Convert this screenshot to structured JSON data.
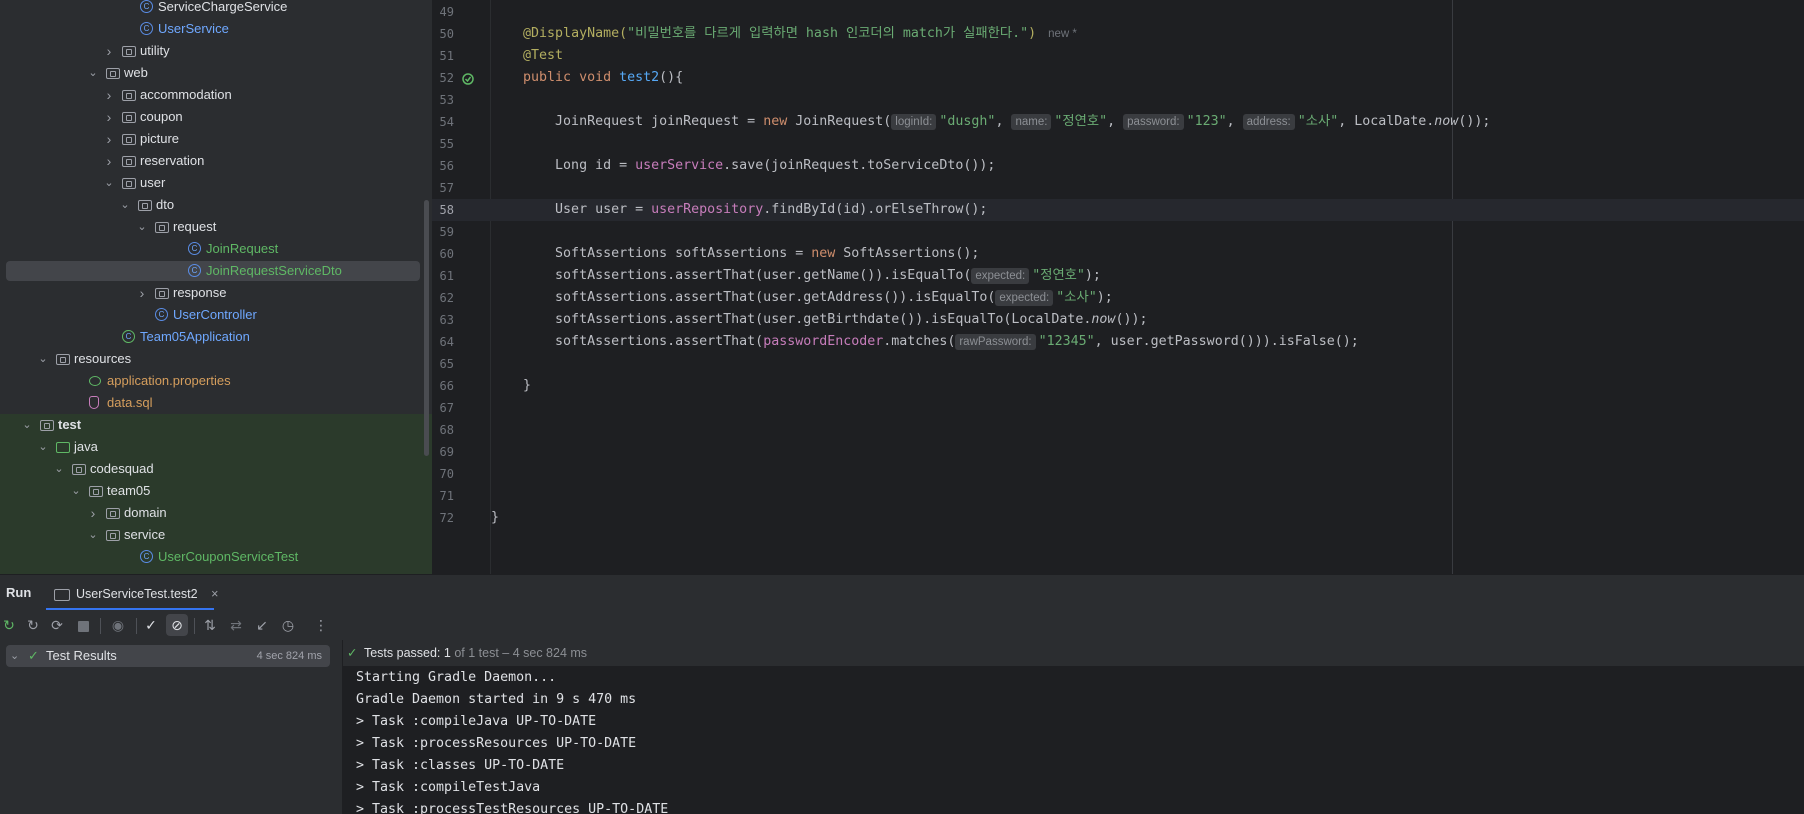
{
  "project_tree": {
    "rows": [
      {
        "label": "ServiceChargeService",
        "icon": "class-icon",
        "chevron": "",
        "color": "white"
      },
      {
        "label": "UserService",
        "icon": "class-icon",
        "chevron": "",
        "color": "blue"
      },
      {
        "label": "utility",
        "icon": "package-icon",
        "chevron": "collapsed",
        "color": "white"
      },
      {
        "label": "web",
        "icon": "package-icon",
        "chevron": "expanded",
        "color": "white"
      },
      {
        "label": "accommodation",
        "icon": "package-icon",
        "chevron": "collapsed",
        "color": "white"
      },
      {
        "label": "coupon",
        "icon": "package-icon",
        "chevron": "collapsed",
        "color": "white"
      },
      {
        "label": "picture",
        "icon": "package-icon",
        "chevron": "collapsed",
        "color": "white"
      },
      {
        "label": "reservation",
        "icon": "package-icon",
        "chevron": "collapsed",
        "color": "white"
      },
      {
        "label": "user",
        "icon": "package-icon",
        "chevron": "expanded",
        "color": "white"
      },
      {
        "label": "dto",
        "icon": "package-icon",
        "chevron": "expanded",
        "color": "white"
      },
      {
        "label": "request",
        "icon": "package-icon",
        "chevron": "expanded",
        "color": "white"
      },
      {
        "label": "JoinRequest",
        "icon": "class-icon",
        "chevron": "",
        "color": "green"
      },
      {
        "label": "JoinRequestServiceDto",
        "icon": "class-icon",
        "chevron": "",
        "color": "green",
        "selected": true
      },
      {
        "label": "response",
        "icon": "package-icon",
        "chevron": "collapsed",
        "color": "white"
      },
      {
        "label": "UserController",
        "icon": "class-icon",
        "chevron": "",
        "color": "blue"
      },
      {
        "label": "Team05Application",
        "icon": "spring-class-icon",
        "chevron": "",
        "color": "blue"
      },
      {
        "label": "resources",
        "icon": "resources-folder-icon",
        "chevron": "expanded",
        "color": "white"
      },
      {
        "label": "application.properties",
        "icon": "properties-file-icon",
        "chevron": "",
        "color": "orange"
      },
      {
        "label": "data.sql",
        "icon": "sql-file-icon",
        "chevron": "",
        "color": "orange"
      },
      {
        "label": "test",
        "icon": "test-folder-icon",
        "chevron": "expanded",
        "color": "white",
        "bold": true
      },
      {
        "label": "java",
        "icon": "source-folder-icon",
        "chevron": "expanded",
        "color": "white"
      },
      {
        "label": "codesquad",
        "icon": "package-icon",
        "chevron": "expanded",
        "color": "white"
      },
      {
        "label": "team05",
        "icon": "package-icon",
        "chevron": "expanded",
        "color": "white"
      },
      {
        "label": "domain",
        "icon": "package-icon",
        "chevron": "collapsed",
        "color": "white"
      },
      {
        "label": "service",
        "icon": "package-icon",
        "chevron": "expanded",
        "color": "white"
      },
      {
        "label": "UserCouponServiceTest",
        "icon": "test-class-icon",
        "chevron": "",
        "color": "green"
      }
    ]
  },
  "editor": {
    "line_numbers": [
      "49",
      "50",
      "51",
      "52",
      "53",
      "54",
      "55",
      "56",
      "57",
      "58",
      "59",
      "60",
      "61",
      "62",
      "63",
      "64",
      "65",
      "66",
      "67",
      "68",
      "69",
      "70",
      "71",
      "72"
    ],
    "current_line": "58",
    "tokens": {
      "display_name_ann": "@DisplayName(",
      "display_name_str": "\"비밀번호를 다르게 입력하면 hash 인코더의 match가 실패한다.\"",
      "display_name_close": ")",
      "new_hint": "new *",
      "test_ann": "@Test",
      "kw_public": "public",
      "kw_void": "void",
      "method_name": "test2",
      "method_tail": "(){",
      "l54_a": "JoinRequest joinRequest = ",
      "kw_new": "new",
      "l54_b": " JoinRequest(",
      "hint_loginId": "loginId:",
      "str_dusgh": "\"dusgh\"",
      "comma": ", ",
      "hint_name": "name:",
      "str_name": "\"정연호\"",
      "hint_password": "password:",
      "str_123": "\"123\"",
      "hint_address": "address:",
      "str_addr": "\"소사\"",
      "l54_c": ", LocalDate.",
      "now": "now",
      "l54_d": "());",
      "l56_a": "Long id = ",
      "fld_userService": "userService",
      "l56_b": ".save(joinRequest.toServiceDto());",
      "l58_a": "User user = ",
      "fld_userRepository": "userRepository",
      "l58_b": ".findById(id).orElseThrow();",
      "l60_a": "SoftAssertions softAssertions = ",
      "l60_b": " SoftAssertions();",
      "l61_a": "softAssertions.assertThat(user.getName()).isEqualTo(",
      "hint_expected": "expected:",
      "l61_b": ");",
      "l62_a": "softAssertions.assertThat(user.getAddress()).isEqualTo(",
      "l63_a": "softAssertions.assertThat(user.getBirthdate()).isEqualTo(LocalDate.",
      "l63_b": "());",
      "l64_a": "softAssertions.assertThat(",
      "fld_passwordEncoder": "passwordEncoder",
      "l64_b": ".matches(",
      "hint_rawPassword": "rawPassword:",
      "str_12345": "\"12345\"",
      "l64_c": ", user.getPassword())).isFalse();",
      "brace_close": "}"
    }
  },
  "run_panel": {
    "title": "Run",
    "tab_label": "UserServiceTest.test2",
    "tab_close": "×",
    "toolbar_icons": [
      "rerun-icon",
      "rerun-failed-icon",
      "toggle-auto-test-icon",
      "stop-icon",
      "show-ignored-icon",
      "show-passed-icon",
      "show-ignored-tests-icon",
      "sort-icon",
      "import-tests-icon",
      "export-tests-icon",
      "history-icon",
      "more-icon"
    ],
    "test_results": {
      "label": "Test Results",
      "duration": "4 sec 824 ms"
    },
    "status": {
      "label": "Tests passed:",
      "passed": "1",
      "of": "of 1 test – 4 sec 824 ms"
    },
    "console_lines": [
      "Starting Gradle Daemon...",
      "Gradle Daemon started in 9 s 470 ms",
      "> Task :compileJava UP-TO-DATE",
      "> Task :processResources UP-TO-DATE",
      "> Task :classes UP-TO-DATE",
      "> Task :compileTestJava",
      "> Task :processTestResources UP-TO-DATE"
    ]
  },
  "colors": {
    "green": "#5fb865",
    "blue": "#6fa8ff",
    "orange": "#d59e5d",
    "accent": "#3574f0"
  }
}
